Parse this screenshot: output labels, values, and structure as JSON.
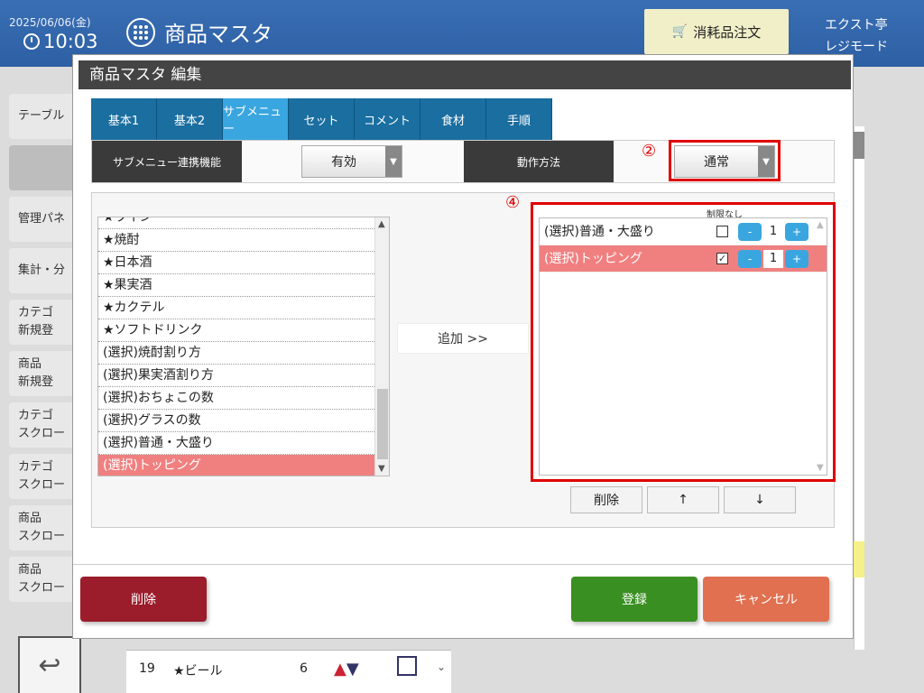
{
  "header": {
    "date": "2025/06/06(金)",
    "time": "10:03",
    "app_title": "商品マスタ",
    "supply_order_label": "消耗品注文",
    "store_name": "エクスト亭",
    "mode_label": "レジモード"
  },
  "sidebar": {
    "items": [
      {
        "line1": "テーブル",
        "line2": ""
      },
      {
        "line1": "",
        "line2": ""
      },
      {
        "line1": "管理パネ",
        "line2": ""
      },
      {
        "line1": "集計・分",
        "line2": ""
      },
      {
        "line1": "カテゴ",
        "line2": "新規登"
      },
      {
        "line1": "商品",
        "line2": "新規登"
      },
      {
        "line1": "カテゴ",
        "line2": "スクロー"
      },
      {
        "line1": "カテゴ",
        "line2": "スクロー"
      },
      {
        "line1": "商品",
        "line2": "スクロー"
      },
      {
        "line1": "商品",
        "line2": "スクロー"
      }
    ]
  },
  "background_row": {
    "num": "19",
    "name": "★ビール",
    "count": "6"
  },
  "modal": {
    "title": "商品マスタ 編集",
    "tabs": [
      "基本1",
      "基本2",
      "サブメニュー",
      "セット",
      "コメント",
      "食材",
      "手順"
    ],
    "active_tab": "サブメニュー",
    "submenu_link_label": "サブメニュー連携機能",
    "submenu_link_value": "有効",
    "operation_label": "動作方法",
    "operation_value": "通常",
    "marker_2": "②",
    "marker_4": "④",
    "left_list": [
      "★ワイン",
      "★焼酎",
      "★日本酒",
      "★果実酒",
      "★カクテル",
      "★ソフトドリンク",
      "(選択)焼酎割り方",
      "(選択)果実酒割り方",
      "(選択)おちょこの数",
      "(選択)グラスの数",
      "(選択)普通・大盛り",
      "(選択)トッピング"
    ],
    "left_selected_index": 11,
    "add_button": "追加 >>",
    "limit_header": "制限なし",
    "right_list": [
      {
        "label": "(選択)普通・大盛り",
        "checked": false,
        "qty": "1",
        "check_glyph": ""
      },
      {
        "label": "(選択)トッピング",
        "checked": true,
        "qty": "1",
        "check_glyph": "✓"
      }
    ],
    "minus_label": "-",
    "plus_label": "+",
    "delete_item_label": "削除",
    "up_label": "↑",
    "down_label": "↓",
    "delete_button": "削除",
    "register_button": "登録",
    "cancel_button": "キャンセル"
  },
  "colors": {
    "topbar": "#2d5fa3",
    "tab": "#1a6ea0",
    "tab_active": "#3aa6e0",
    "highlight_row": "#f08080",
    "annotation_red": "#e00000",
    "delete_btn": "#9b1c2a",
    "register_btn": "#3a8f22",
    "cancel_btn": "#e07050"
  }
}
